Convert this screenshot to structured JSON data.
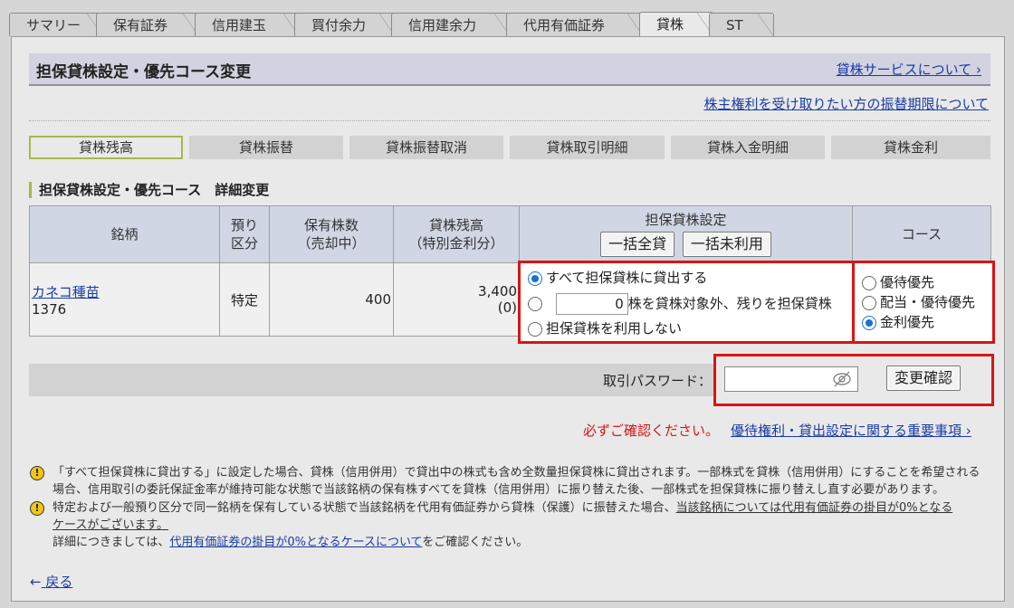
{
  "tabs": [
    "サマリー",
    "保有証券",
    "信用建玉",
    "買付余力",
    "信用建余力",
    "代用有価証券",
    "貸株",
    "ST"
  ],
  "active_tab": "貸株",
  "header": {
    "title": "担保貸株設定・優先コース変更",
    "service_link": "貸株サービスについて",
    "holder_link": "株主権利を受け取りたい方の振替期限について"
  },
  "subnav": [
    "貸株残高",
    "貸株振替",
    "貸株振替取消",
    "貸株取引明細",
    "貸株入金明細",
    "貸株金利"
  ],
  "section_title": "担保貸株設定・優先コース　詳細変更",
  "table": {
    "headers": {
      "stock": "銘柄",
      "account_1": "預り",
      "account_2": "区分",
      "held_1": "保有株数",
      "held_2": "（売却中）",
      "balance_1": "貸株残高",
      "balance_2": "（特別金利分）",
      "collateral": "担保貸株設定",
      "course": "コース"
    },
    "bulk_all": "一括全貸",
    "bulk_none": "一括未利用",
    "row": {
      "stock_name": "カネコ種苗",
      "stock_code": "1376",
      "account": "特定",
      "held": "400",
      "balance": "3,400",
      "balance_special": "(0)"
    }
  },
  "collateral_options": {
    "opt1": "すべて担保貸株に貸出する",
    "qty_value": "0",
    "opt2_suffix": "株を貸株対象外、残りを担保貸株",
    "opt3": "担保貸株を利用しない",
    "selected": 1
  },
  "course_options": {
    "opt1": "優待優先",
    "opt2": "配当・優待優先",
    "opt3": "金利優先",
    "selected": 3
  },
  "password": {
    "label": "取引パスワード：",
    "confirm_button": "変更確認"
  },
  "notice": {
    "red": "必ずご確認ください。",
    "link": "優待権利・貸出設定に関する重要事項"
  },
  "notes": {
    "n1_line1": "「すべて担保貸株に貸出する」に設定した場合、貸株（信用併用）で貸出中の株式も含め全数量担保貸株に貸出されます。一部株式を貸株（信用併用）にすることを希望される",
    "n1_line2": "場合、信用取引の委託保証金率が維持可能な状態で当該銘柄の保有株すべてを貸株（信用併用）に振り替えた後、一部株式を担保貸株に振り替えし直す必要があります。",
    "n2_line1": "特定および一般預り区分で同一銘柄を保有している状態で当該銘柄を代用有価証券から貸株（保護）に振替えた場合、",
    "n2_link1": "当該銘柄については代用有価証券の掛目が0%となる",
    "n2_link2": "ケースがございます。",
    "n2_line3a": "詳細につきましては、",
    "n2_line3_link": "代用有価証券の掛目が0%となるケースについて",
    "n2_line3b": "をご確認ください。"
  },
  "back": "戻る"
}
